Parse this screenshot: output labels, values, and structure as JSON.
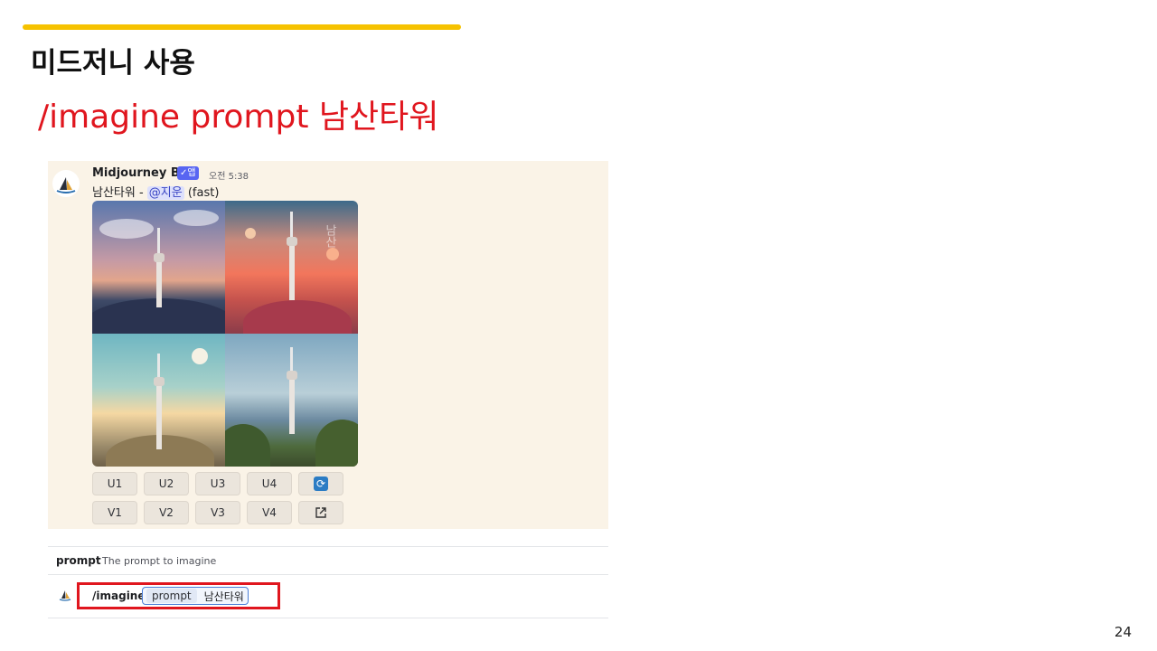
{
  "slide": {
    "title": "미드저니 사용",
    "subtitle": "/imagine prompt 남산타워",
    "page_number": "24",
    "accent_color": "#f6c200",
    "subtitle_color": "#e0161e"
  },
  "message": {
    "bot_name": "Midjourney Bot",
    "app_badge": "✓앱",
    "timestamp": "오전 5:38",
    "text_prefix": "남산타워 - ",
    "mention": "@지운",
    "text_suffix": " (fast)",
    "image_cell_overlay_text": "남산"
  },
  "buttons": {
    "upscale": [
      "U1",
      "U2",
      "U3",
      "U4"
    ],
    "variation": [
      "V1",
      "V2",
      "V3",
      "V4"
    ],
    "reroll_icon": "refresh-icon",
    "open_icon": "external-link-icon"
  },
  "command": {
    "option_name": "prompt",
    "option_description": "The prompt to imagine",
    "command_name": "/imagine",
    "param_name": "prompt",
    "param_value": "남산타워",
    "highlight_color": "#e0161e"
  }
}
